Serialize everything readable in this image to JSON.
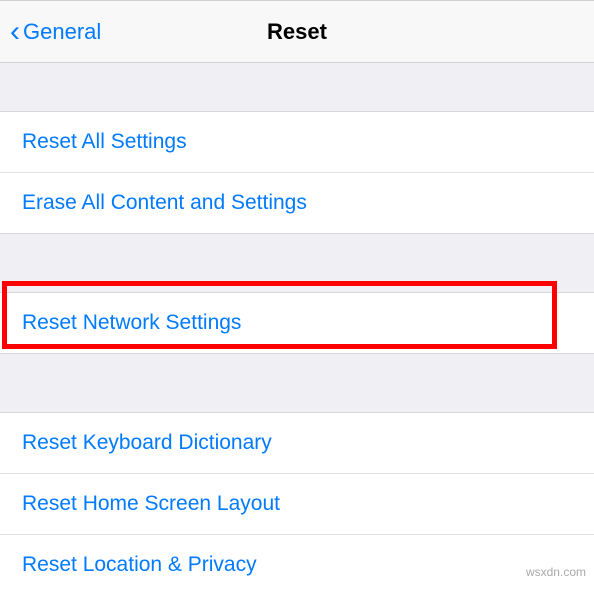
{
  "nav": {
    "back_label": "General",
    "title": "Reset"
  },
  "groups": [
    {
      "items": [
        {
          "label": "Reset All Settings",
          "name": "reset-all-settings"
        },
        {
          "label": "Erase All Content and Settings",
          "name": "erase-all-content-settings"
        }
      ]
    },
    {
      "items": [
        {
          "label": "Reset Network Settings",
          "name": "reset-network-settings"
        }
      ],
      "highlighted": true
    },
    {
      "items": [
        {
          "label": "Reset Keyboard Dictionary",
          "name": "reset-keyboard-dictionary"
        },
        {
          "label": "Reset Home Screen Layout",
          "name": "reset-home-screen-layout"
        },
        {
          "label": "Reset Location & Privacy",
          "name": "reset-location-privacy"
        }
      ]
    }
  ],
  "watermark": "wsxdn.com"
}
